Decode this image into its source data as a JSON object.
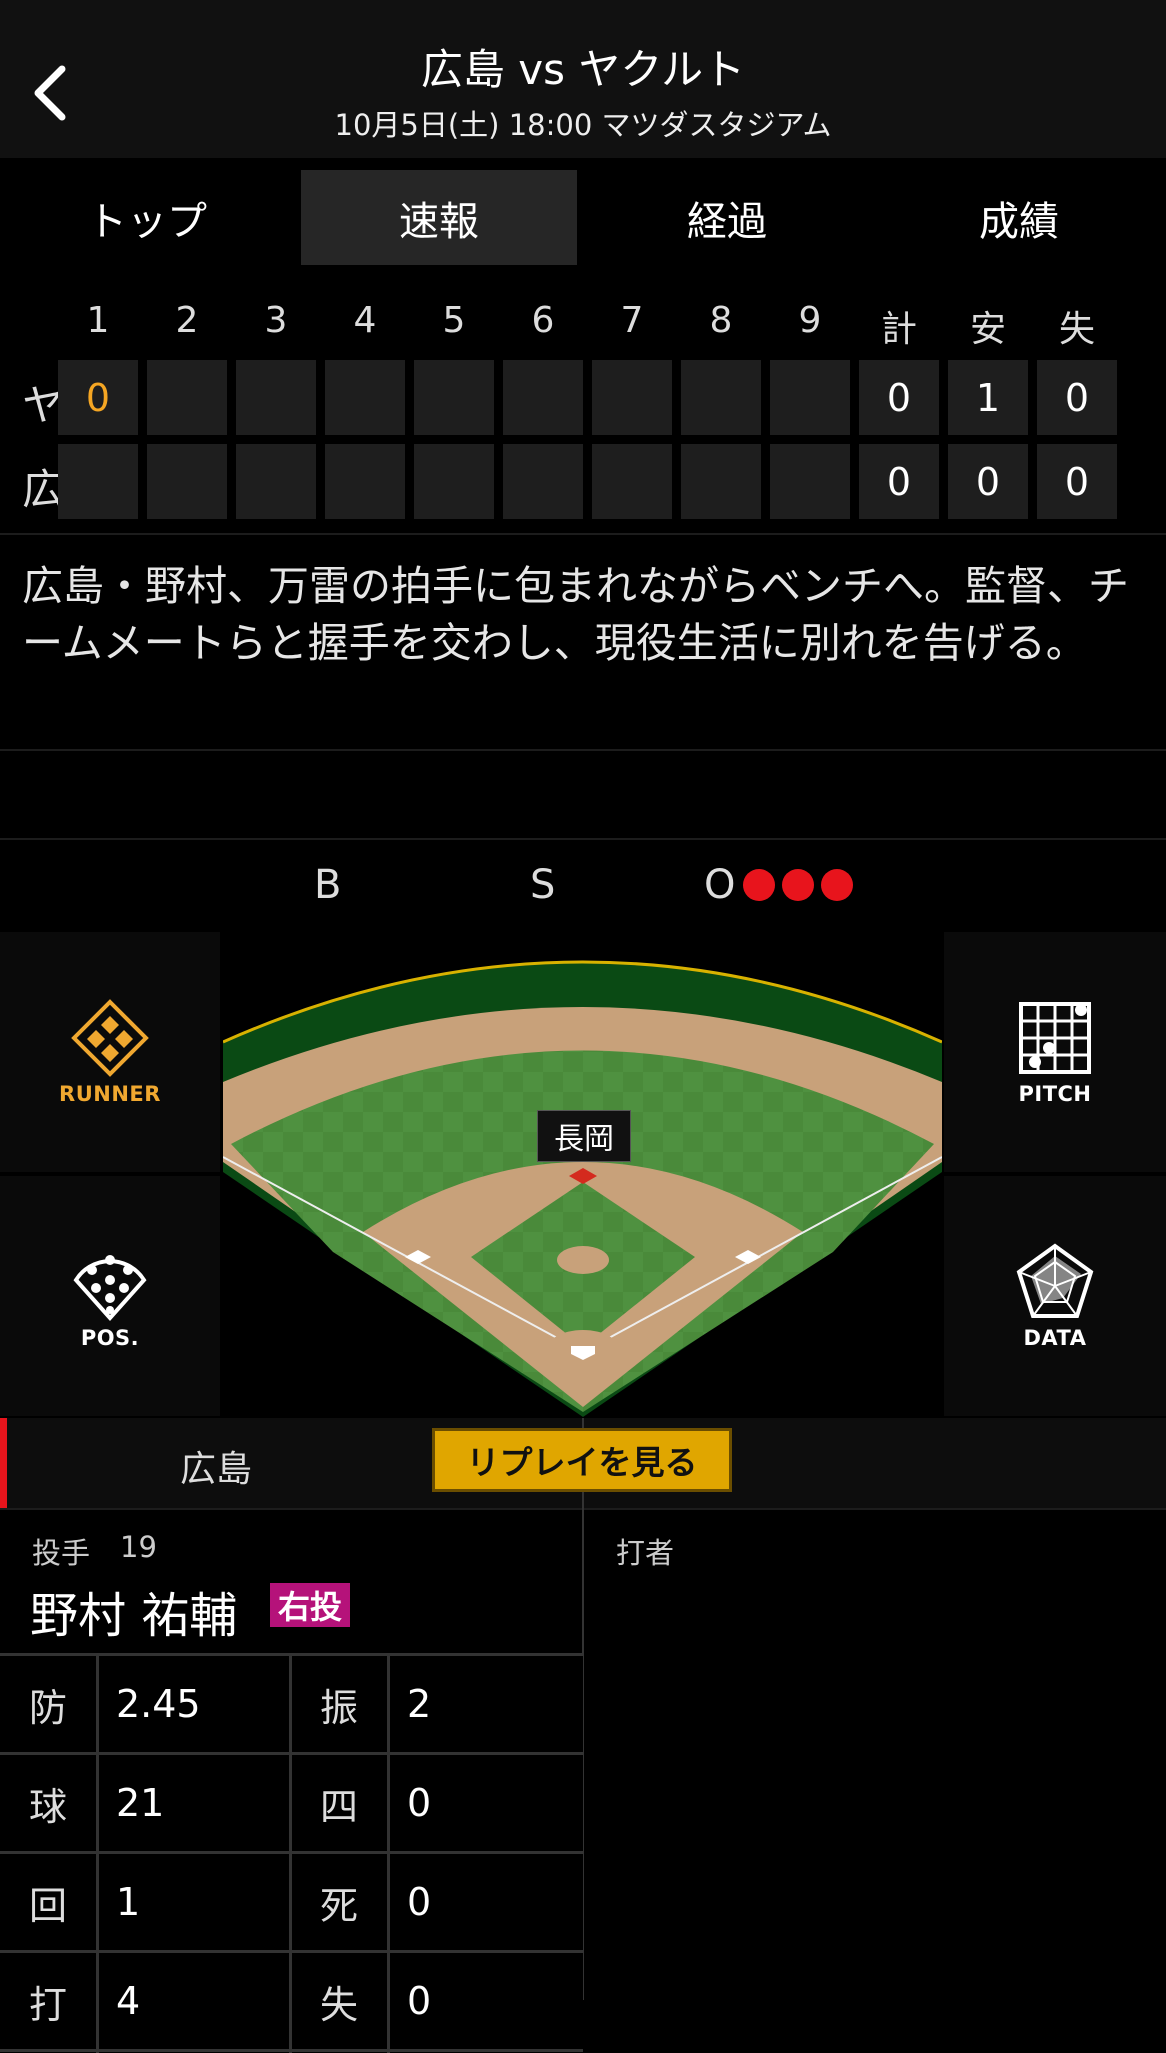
{
  "header": {
    "title": "広島 vs ヤクルト",
    "subtitle": "10月5日(土) 18:00 マツダスタジアム"
  },
  "tabs": [
    {
      "label": "トップ",
      "active": false
    },
    {
      "label": "速報",
      "active": true
    },
    {
      "label": "経過",
      "active": false
    },
    {
      "label": "成績",
      "active": false
    }
  ],
  "scoreboard": {
    "headers": [
      "1",
      "2",
      "3",
      "4",
      "5",
      "6",
      "7",
      "8",
      "9",
      "計",
      "安",
      "失"
    ],
    "teams": [
      {
        "name": "ヤ",
        "innings": [
          "0",
          "",
          "",
          "",
          "",
          "",
          "",
          "",
          ""
        ],
        "totals": [
          "0",
          "1",
          "0"
        ]
      },
      {
        "name": "広",
        "innings": [
          "",
          "",
          "",
          "",
          "",
          "",
          "",
          "",
          ""
        ],
        "totals": [
          "0",
          "0",
          "0"
        ]
      }
    ],
    "highlight_color": "#f5a623"
  },
  "description": "広島・野村、万雷の拍手に包まれながらベンチへ。監督、チームメートらと握手を交わし、現役生活に別れを告げる。",
  "count": {
    "balls_label": "B",
    "strikes_label": "S",
    "outs_label": "O",
    "balls": 0,
    "strikes": 0,
    "outs": 3,
    "out_color": "#e8141c"
  },
  "buttons": {
    "runner": "RUNNER",
    "pitch": "PITCH",
    "pos": "POS.",
    "data": "DATA"
  },
  "field": {
    "pitcher_tag": "長岡"
  },
  "team_bar": {
    "team": "広島",
    "replay": "リプレイを見る",
    "team_color": "#e8141c"
  },
  "pitcher": {
    "role_label": "投手",
    "number": "19",
    "name": "野村 祐輔",
    "throws": "右投",
    "throws_color": "#b5127a"
  },
  "batter": {
    "role_label": "打者"
  },
  "stats": [
    {
      "l1": "防",
      "v1": "2.45",
      "l2": "振",
      "v2": "2"
    },
    {
      "l1": "球",
      "v1": "21",
      "l2": "四",
      "v2": "0"
    },
    {
      "l1": "回",
      "v1": "1",
      "l2": "死",
      "v2": "0"
    },
    {
      "l1": "打",
      "v1": "4",
      "l2": "失",
      "v2": "0"
    }
  ]
}
